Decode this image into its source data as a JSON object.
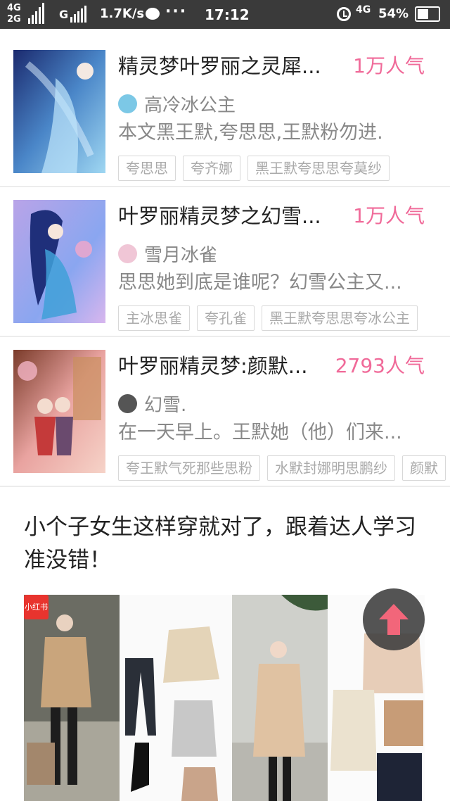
{
  "status_bar": {
    "network_top": "4G",
    "network_bottom": "2G",
    "g_label": "G",
    "speed": "1.7K/s",
    "more": "···",
    "time": "17:12",
    "network_4g": "4G",
    "battery_percent": "54%",
    "battery_level": 0.54
  },
  "stories": [
    {
      "title": "精灵梦叶罗丽之灵犀...",
      "popularity": "1万人气",
      "author": "高冷冰公主",
      "description": "本文黑王默,夸思思,王默粉勿进.",
      "tags": [
        "夸思思",
        "夸齐娜",
        "黑王默夸思思夸莫纱"
      ]
    },
    {
      "title": "叶罗丽精灵梦之幻雪...",
      "popularity": "1万人气",
      "author": "雪月冰雀",
      "description": "思思她到底是谁呢？幻雪公主又...",
      "tags": [
        "主冰思雀",
        "夸孔雀",
        "黑王默夸思思夸冰公主"
      ]
    },
    {
      "title": "叶罗丽精灵梦:颜默...",
      "popularity": "2793人气",
      "author": "幻雪.",
      "description": "在一天早上。王默她（他）们来...",
      "tags": [
        "夸王默气死那些思粉",
        "水默封娜明思鹏纱",
        "颜默"
      ]
    }
  ],
  "article": {
    "title": "小个子女生这样穿就对了，跟着达人学习准没错！",
    "badge": "小红书"
  },
  "icons": {
    "scroll_top": "up-arrow-icon"
  },
  "colors": {
    "popularity": "#f06a99",
    "status_bar": "#3a3a3a",
    "fab_arrow": "#f2667a"
  }
}
